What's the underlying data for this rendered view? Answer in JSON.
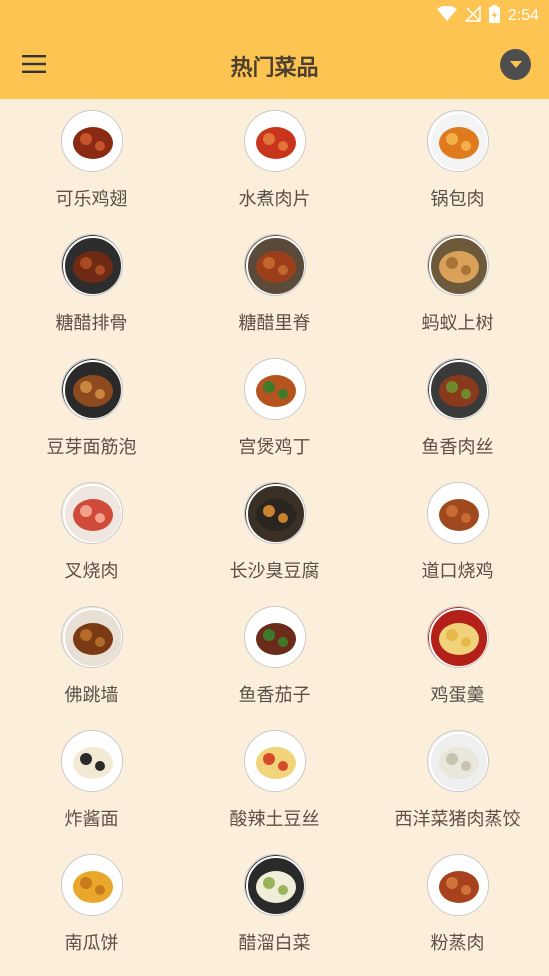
{
  "status_bar": {
    "time": "2:54"
  },
  "header": {
    "title": "热门菜品"
  },
  "dishes": [
    {
      "name": "可乐鸡翅",
      "plate": "#ffffff",
      "food": "#8a2a12",
      "accent": "#c7542a"
    },
    {
      "name": "水煮肉片",
      "plate": "#ffffff",
      "food": "#c8351b",
      "accent": "#e2733a"
    },
    {
      "name": "锅包肉",
      "plate": "#f4f4f4",
      "food": "#e07a1e",
      "accent": "#f3b04a"
    },
    {
      "name": "糖醋排骨",
      "plate": "#2d2d2d",
      "food": "#6e2a12",
      "accent": "#a84a22"
    },
    {
      "name": "糖醋里脊",
      "plate": "#5a4a3a",
      "food": "#9a3f1a",
      "accent": "#c3662e"
    },
    {
      "name": "蚂蚁上树",
      "plate": "#6d5a3a",
      "food": "#d9a15a",
      "accent": "#a77436"
    },
    {
      "name": "豆芽面筋泡",
      "plate": "#2a2a2a",
      "food": "#8c4a1e",
      "accent": "#c9853e"
    },
    {
      "name": "宫煲鸡丁",
      "plate": "#ffffff",
      "food": "#b5541e",
      "accent": "#3f7a2a"
    },
    {
      "name": "鱼香肉丝",
      "plate": "#3a3a3a",
      "food": "#8a3a1c",
      "accent": "#6f8a2a"
    },
    {
      "name": "叉烧肉",
      "plate": "#f0e6e0",
      "food": "#d04a3a",
      "accent": "#f2a08a"
    },
    {
      "name": "长沙臭豆腐",
      "plate": "#3a3026",
      "food": "#2b2520",
      "accent": "#c9822e"
    },
    {
      "name": "道口烧鸡",
      "plate": "#ffffff",
      "food": "#9e4a1e",
      "accent": "#c76a34"
    },
    {
      "name": "佛跳墙",
      "plate": "#e8e0d4",
      "food": "#7a3b14",
      "accent": "#b36b2a"
    },
    {
      "name": "鱼香茄子",
      "plate": "#ffffff",
      "food": "#6b2b1a",
      "accent": "#3f7a2a"
    },
    {
      "name": "鸡蛋羹",
      "plate": "#b3201a",
      "food": "#f0d27a",
      "accent": "#e8b94a"
    },
    {
      "name": "炸酱面",
      "plate": "#ffffff",
      "food": "#f3ead6",
      "accent": "#2a2a2a"
    },
    {
      "name": "酸辣土豆丝",
      "plate": "#ffffff",
      "food": "#f2d47a",
      "accent": "#d64a2a"
    },
    {
      "name": "西洋菜猪肉蒸饺",
      "plate": "#efefef",
      "food": "#e9e6dc",
      "accent": "#c8c2b0"
    },
    {
      "name": "南瓜饼",
      "plate": "#ffffff",
      "food": "#e9a82a",
      "accent": "#c97a1a"
    },
    {
      "name": "醋溜白菜",
      "plate": "#2a2a2a",
      "food": "#f0eed8",
      "accent": "#9ab45a"
    },
    {
      "name": "粉蒸肉",
      "plate": "#ffffff",
      "food": "#a8421e",
      "accent": "#d0743a"
    }
  ]
}
